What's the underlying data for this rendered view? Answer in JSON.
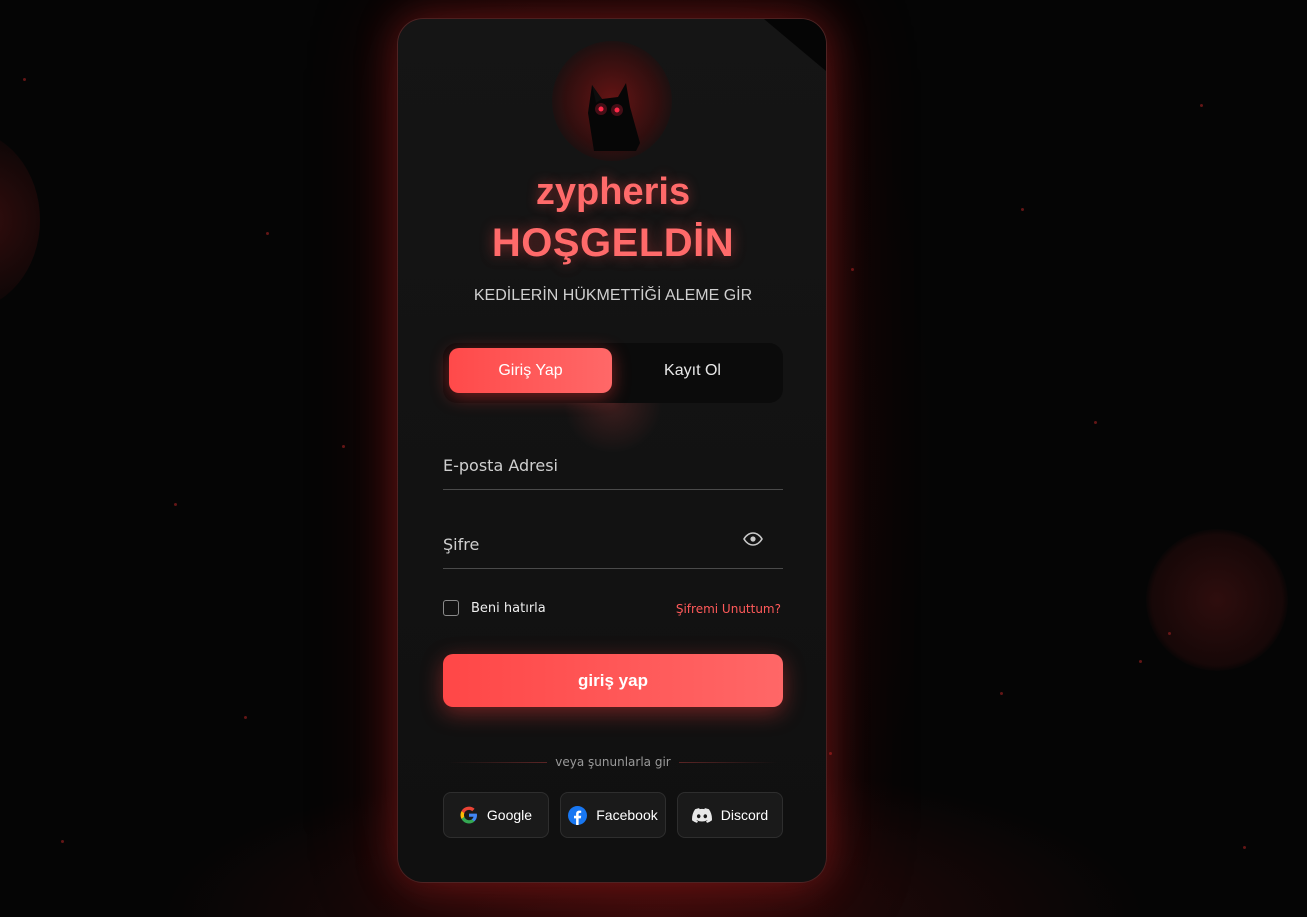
{
  "brand": {
    "name": "zypheris",
    "avatar_icon": "cat-icon"
  },
  "header": {
    "title": "HOŞGELDİN",
    "subtitle": "KEDİLERİN HÜKMETTİĞİ ALEME GİR"
  },
  "tabs": [
    {
      "label": "Giriş Yap",
      "active": true
    },
    {
      "label": "Kayıt Ol",
      "active": false
    }
  ],
  "form": {
    "email_placeholder": "E-posta Adresi",
    "password_placeholder": "Şifre",
    "show_password_icon": "eye-icon",
    "remember_label": "Beni hatırla",
    "forgot_label": "Şifremi Unuttum?",
    "submit_label": "giriş yap"
  },
  "social": {
    "divider_text": "veya şununlarla gir",
    "buttons": [
      {
        "label": "Google",
        "icon": "google-icon"
      },
      {
        "label": "Facebook",
        "icon": "facebook-icon"
      },
      {
        "label": "Discord",
        "icon": "discord-icon"
      }
    ]
  },
  "colors": {
    "accent": "#ff5555",
    "accent_text": "#ff6a6a",
    "background": "#050505",
    "card": "#131313"
  }
}
